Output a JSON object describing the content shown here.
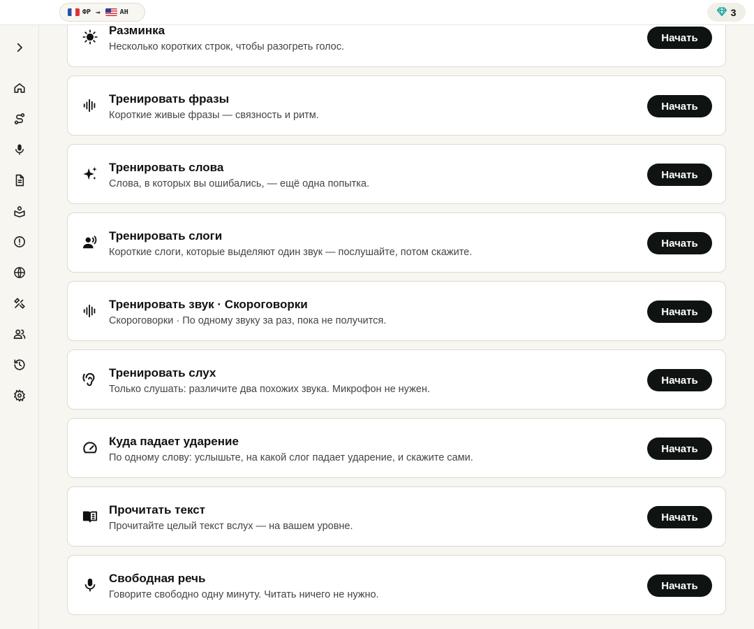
{
  "header": {
    "language_pair": {
      "from_code": "ФР",
      "to_code": "АН",
      "from_flag": "france-flag",
      "to_flag": "us-flag",
      "arrow": "→"
    },
    "gems": {
      "icon": "gem-icon",
      "count": "3",
      "color": "#1aa6a0"
    }
  },
  "sidebar": {
    "items": [
      {
        "name": "expand",
        "icon": "chevron-right-icon"
      },
      {
        "name": "home",
        "icon": "home-icon"
      },
      {
        "name": "path",
        "icon": "route-icon"
      },
      {
        "name": "speak",
        "icon": "mic-icon"
      },
      {
        "name": "documents",
        "icon": "document-icon"
      },
      {
        "name": "learn",
        "icon": "book-user-icon"
      },
      {
        "name": "mistakes",
        "icon": "alert-circle-icon"
      },
      {
        "name": "languages",
        "icon": "globe-icon"
      },
      {
        "name": "tools",
        "icon": "wrench-icon"
      },
      {
        "name": "community",
        "icon": "users-icon"
      },
      {
        "name": "history",
        "icon": "history-icon"
      },
      {
        "name": "settings",
        "icon": "gear-icon"
      }
    ]
  },
  "exercises": [
    {
      "icon": "sun-icon",
      "title": "Разминка",
      "description": "Несколько коротких строк, чтобы разогреть голос.",
      "button": "Начать"
    },
    {
      "icon": "audio-waveform-icon",
      "title": "Тренировать фразы",
      "description": "Короткие живые фразы — связность и ритм.",
      "button": "Начать"
    },
    {
      "icon": "sparkles-icon",
      "title": "Тренировать слова",
      "description": "Слова, в которых вы ошибались, — ещё одна попытка.",
      "button": "Начать"
    },
    {
      "icon": "speaking-person-icon",
      "title": "Тренировать слоги",
      "description": "Короткие слоги, которые выделяют один звук — послушайте, потом скажите.",
      "button": "Начать"
    },
    {
      "icon": "audio-waveform-icon",
      "title": "Тренировать звук · Скороговорки",
      "description": "Скороговорки · По одному звуку за раз, пока не получится.",
      "button": "Начать"
    },
    {
      "icon": "ear-icon",
      "title": "Тренировать слух",
      "description": "Только слушать: различите два похожих звука. Микрофон не нужен.",
      "button": "Начать"
    },
    {
      "icon": "gauge-icon",
      "title": "Куда падает ударение",
      "description": "По одному слову: услышьте, на какой слог падает ударение, и скажите сами.",
      "button": "Начать"
    },
    {
      "icon": "open-book-icon",
      "title": "Прочитать текст",
      "description": "Прочитайте целый текст вслух — на вашем уровне.",
      "button": "Начать"
    },
    {
      "icon": "mic-icon",
      "title": "Свободная речь",
      "description": "Говорите свободно одну минуту. Читать ничего не нужно.",
      "button": "Начать"
    }
  ]
}
